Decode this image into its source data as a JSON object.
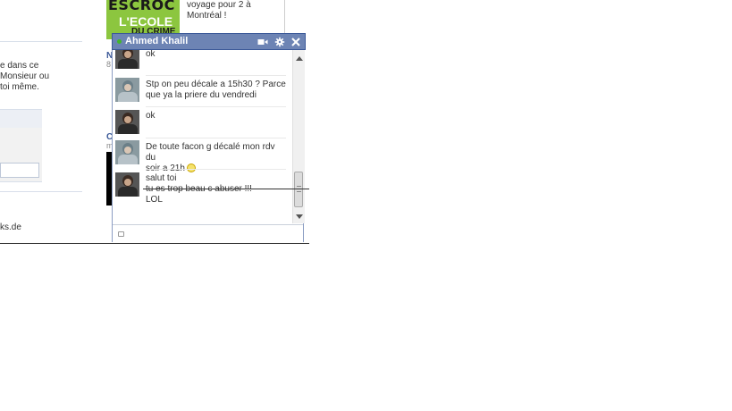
{
  "background": {
    "left_text": [
      "e dans ce",
      "Monsieur ou",
      "toi même."
    ],
    "domain_text": "ks.de",
    "ad": {
      "image_text": [
        "ESCROC",
        "L'ECOLE",
        "DU CRIME"
      ],
      "text": "voyage pour 2 à Montréal !"
    },
    "fragments": {
      "name": "N",
      "number": "8",
      "c": "C",
      "m": "m"
    }
  },
  "chat": {
    "contact_name": "Ahmed Khalil",
    "header_icons": [
      "video-icon",
      "gear-icon",
      "close-icon"
    ],
    "messages": [
      {
        "avatar": "dark",
        "lines": [
          "ok"
        ]
      },
      {
        "avatar": "light",
        "lines": [
          "Stp on peu décale a 15h30 ? Parce",
          "que ya la priere du vendredi"
        ]
      },
      {
        "avatar": "dark",
        "lines": [
          "ok"
        ]
      },
      {
        "avatar": "light",
        "lines": [
          "De toute facon g décalé mon rdv du",
          "soir a 21h"
        ],
        "emoticon": "smiley"
      },
      {
        "avatar": "dark",
        "lines": [
          "salut toi",
          "tu es trop beau c abuser !!!",
          "LOL"
        ]
      }
    ],
    "input_value": ""
  },
  "colors": {
    "header_bg": "#6d84b4",
    "header_border": "#3b5998",
    "online_dot": "#42b72a",
    "ad_green": "#8cc63f"
  }
}
